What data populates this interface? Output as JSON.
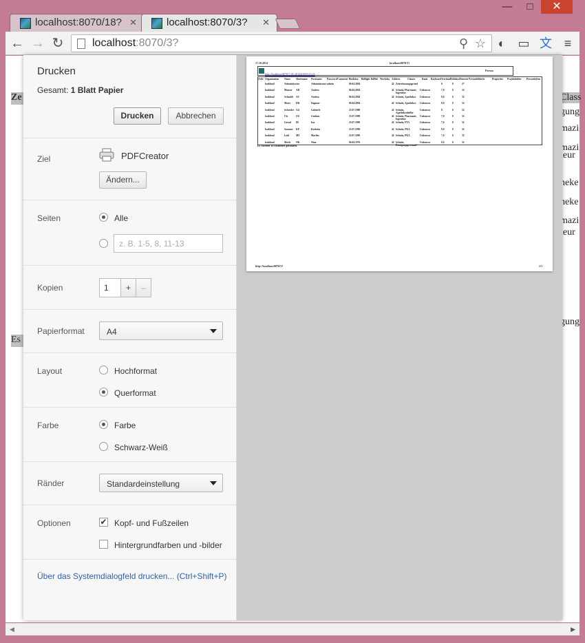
{
  "tabs": [
    {
      "title": "localhost:8070/18?",
      "active": false
    },
    {
      "title": "localhost:8070/3?",
      "active": true
    }
  ],
  "window": {
    "minimize": "—",
    "maximize": "□",
    "close": "✕"
  },
  "address_bar": {
    "host": "localhost",
    "path": ":8070/3?"
  },
  "page_behind": {
    "header_cell": "Ze",
    "footer_cell": "Es",
    "right_column": [
      "Class",
      "gung",
      "mazi",
      "mazi",
      "ieur",
      "heke",
      "heke",
      "mazi",
      "ieur",
      "gung"
    ]
  },
  "print_dialog": {
    "title": "Drucken",
    "total_prefix": "Gesamt:",
    "total_value": "1 Blatt Papier",
    "print_button": "Drucken",
    "cancel_button": "Abbrechen",
    "destination": {
      "label": "Ziel",
      "printer": "PDFCreator",
      "change_button": "Ändern..."
    },
    "pages": {
      "label": "Seiten",
      "all": "Alle",
      "custom_placeholder": "z. B. 1-5, 8, 11-13",
      "selected": "all"
    },
    "copies": {
      "label": "Kopien",
      "value": "1",
      "plus": "+",
      "minus": "–"
    },
    "paper": {
      "label": "Papierformat",
      "value": "A4"
    },
    "layout": {
      "label": "Layout",
      "portrait": "Hochformat",
      "landscape": "Querformat",
      "selected": "landscape"
    },
    "color": {
      "label": "Farbe",
      "color": "Farbe",
      "bw": "Schwarz-Weiß",
      "selected": "color"
    },
    "margins": {
      "label": "Ränder",
      "value": "Standardeinstellung"
    },
    "options": {
      "label": "Optionen",
      "headers_footers": "Kopf- und Fußzeilen",
      "headers_footers_checked": true,
      "backgrounds": "Hintergrundfarben und -bilder",
      "backgrounds_checked": false
    },
    "system_dialog_link": "Über das Systemdialogfeld drucken... (Ctrl+Shift+P)"
  },
  "preview": {
    "date": "17.10.2014",
    "url": "localhost:8070/3?",
    "box_link": "http://localhost:8070/?.18/.2014/0:00/0:23:41",
    "box_title": "Person",
    "columns": [
      "Zeile",
      "Organisation",
      "Name",
      "Shortname",
      "Firstname",
      "Password",
      "Comment",
      "Birthday",
      "Bdflight",
      "Bdflid",
      "Workday",
      "Address",
      "Classes",
      "Rank",
      "Rayhours",
      "Overtime",
      "Holidays",
      "Timeout",
      "Personbilderbe",
      "Properties",
      "Projektbilder",
      "Personbylten"
    ],
    "rows": [
      [
        "",
        "loublond",
        "Administrator",
        "",
        "Administrator admin",
        "",
        "",
        "06.04.2004",
        "",
        "",
        "",
        "42",
        "Zeiterfassungsgrund",
        "",
        "6",
        "0",
        "27"
      ],
      [
        "",
        "loublond",
        "Mauser",
        "AD",
        "Andrea",
        "",
        "",
        "06.04.2004",
        "",
        "",
        "",
        "42",
        "Schnitz, Pharmazie, Ingenieur",
        "Unknown",
        "7,0",
        "0",
        "32"
      ],
      [
        "",
        "loublond",
        "Schmidt",
        "AS",
        "Andrea",
        "",
        "",
        "06.04.2004",
        "",
        "",
        "",
        "42",
        "Schnitz, Apotheker",
        "Unknown",
        "8,0",
        "0",
        "32"
      ],
      [
        "",
        "loublond",
        "Meier",
        "DK",
        "Dagmar",
        "",
        "",
        "06.04.2004",
        "",
        "",
        "",
        "42",
        "Schnitz, Apotheker",
        "Unknown",
        "8,0",
        "0",
        "32"
      ],
      [
        "",
        "loublond",
        "Schröder",
        "GG",
        "Gabriele",
        "",
        "",
        "23.07.1990",
        "",
        "",
        "",
        "42",
        "Schnitz, Apothekenhelfer",
        "Unknown",
        "8",
        "0",
        "32"
      ],
      [
        "",
        "loublond",
        "Ute",
        "GU",
        "Gudrun",
        "",
        "",
        "23.07.1990",
        "",
        "",
        "",
        "42",
        "Schnitz, Pharmazie, Ingenieur",
        "Unknown",
        "7,0",
        "0",
        "32"
      ],
      [
        "",
        "loublond",
        "Gerud",
        "IB",
        "Ina",
        "",
        "",
        "23.07.1990",
        "",
        "",
        "",
        "42",
        "Schnitz, PTA",
        "Unknown",
        "7,0",
        "0",
        "32"
      ],
      [
        "",
        "loublond",
        "Sommer",
        "KP",
        "Karlotta",
        "",
        "",
        "23.07.1990",
        "",
        "",
        "",
        "42",
        "Schnitz, PKA",
        "Unknown",
        "8,0",
        "0",
        "32"
      ],
      [
        "",
        "loublond",
        "Lohl",
        "MS",
        "Marlies",
        "",
        "",
        "23.07.1990",
        "",
        "",
        "",
        "42",
        "Schnitz, PKA",
        "Unknown",
        "7,0",
        "0",
        "32"
      ],
      [
        "",
        "loublond",
        "Merle",
        "NK",
        "Nina",
        "",
        "",
        "06.04.1976",
        "",
        "",
        "",
        "42",
        "Schnitz, Reinigungspersonal",
        "Unknown",
        "8,0",
        "0",
        "32"
      ]
    ],
    "found_text": "Es wurden 10 Elemente gefunden.",
    "footer_url": "http://localhost:8070/3?",
    "footer_page": "1/1"
  }
}
